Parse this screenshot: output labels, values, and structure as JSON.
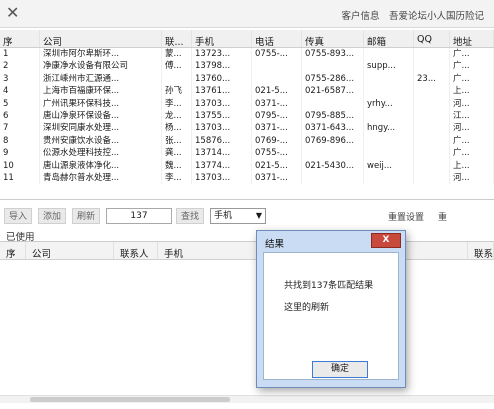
{
  "window": {
    "close_glyph": "✕",
    "title": "客户信息　吾爱论坛小人国历险记"
  },
  "grid": {
    "columns": [
      "序",
      "公司",
      "联...",
      "手机",
      "电话",
      "传真",
      "邮箱",
      "QQ",
      "地址"
    ],
    "rows": [
      [
        "1",
        "深圳市阿尔卑斯环...",
        "蒙...",
        "13723...",
        "0755-...",
        "0755-893...",
        "",
        "",
        "广..."
      ],
      [
        "2",
        "净康净水设备有限公司",
        "傅...",
        "13798...",
        "",
        "",
        "supp...",
        "",
        "广..."
      ],
      [
        "3",
        "浙江嵊州市汇源通...",
        "",
        "13760...",
        "",
        "0755-286...",
        "",
        "23...",
        "广..."
      ],
      [
        "4",
        "上海市百福康环保...",
        "孙飞",
        "13761...",
        "021-5...",
        "021-6587...",
        "",
        "",
        "上..."
      ],
      [
        "5",
        "广州讯果环保科技...",
        "李...",
        "13703...",
        "0371-...",
        "",
        "yrhy...",
        "",
        "河..."
      ],
      [
        "6",
        "唐山净泉环保设备...",
        "龙...",
        "13755...",
        "0795-...",
        "0795-885...",
        "",
        "",
        "江..."
      ],
      [
        "7",
        "深圳安同康水处理...",
        "杨...",
        "13703...",
        "0371-...",
        "0371-643...",
        "hngy...",
        "",
        "河..."
      ],
      [
        "8",
        "贵州安康饮水设备...",
        "张...",
        "15876...",
        "0769-...",
        "0769-896...",
        "",
        "",
        "广..."
      ],
      [
        "9",
        "伀源水处理科技控...",
        "龚...",
        "13714...",
        "0755-...",
        "",
        "",
        "",
        "广..."
      ],
      [
        "10",
        "唐山源泉液体净化...",
        "魏...",
        "13774...",
        "021-5...",
        "021-5430...",
        "weij...",
        "",
        "上..."
      ],
      [
        "11",
        "青岛赫尔普水处理...",
        "李...",
        "13703...",
        "0371-...",
        "",
        "",
        "",
        "河..."
      ]
    ]
  },
  "toolbar": {
    "import": "导入",
    "add": "添加",
    "refresh": "刷新",
    "count": "137",
    "search": "查找",
    "search_field": "手机",
    "settings": "重置设置",
    "reset": "重"
  },
  "used": {
    "label": "已使用",
    "columns": [
      "序",
      "公司",
      "联系人",
      "手机",
      "联系"
    ]
  },
  "dialog": {
    "title": "结果",
    "close_glyph": "X",
    "message_line1": "共找到137条匹配结果",
    "message_line2": "这里的刷新",
    "ok_label": "确定"
  }
}
